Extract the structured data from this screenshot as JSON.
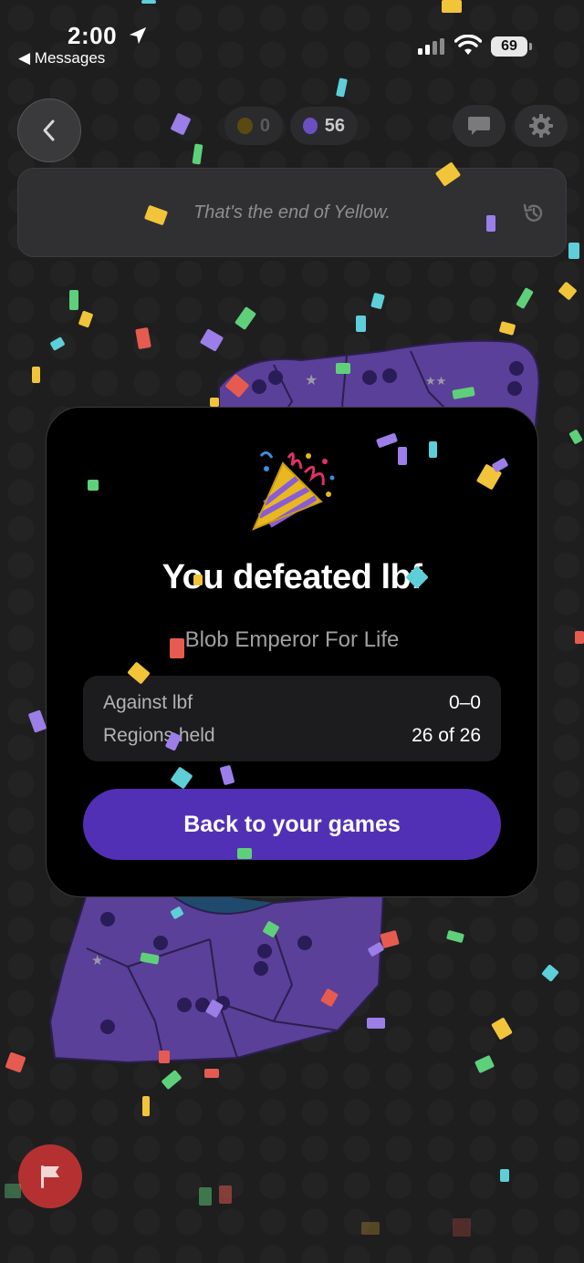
{
  "status_bar": {
    "time": "2:00",
    "back_label": "◀ Messages",
    "battery": "69"
  },
  "header": {
    "yellow_score": "0",
    "purple_score": "56",
    "message": "That's the end of Yellow."
  },
  "modal": {
    "title": "You defeated lbf",
    "subtitle": "Blob Emperor For Life",
    "stats": [
      {
        "label": "Against lbf",
        "value": "0–0"
      },
      {
        "label": "Regions held",
        "value": "26 of 26"
      }
    ],
    "button_label": "Back to your games"
  },
  "colors": {
    "accent_purple": "#5230b5",
    "player_purple": "#6b4fc2",
    "player_yellow": "#e3b81c",
    "flag_red": "#b53131"
  },
  "icons": [
    "chevron-left-icon",
    "chat-bubble-icon",
    "gear-icon",
    "history-icon",
    "party-popper-icon",
    "flag-icon",
    "location-arrow-icon",
    "signal-icon",
    "wifi-icon"
  ]
}
